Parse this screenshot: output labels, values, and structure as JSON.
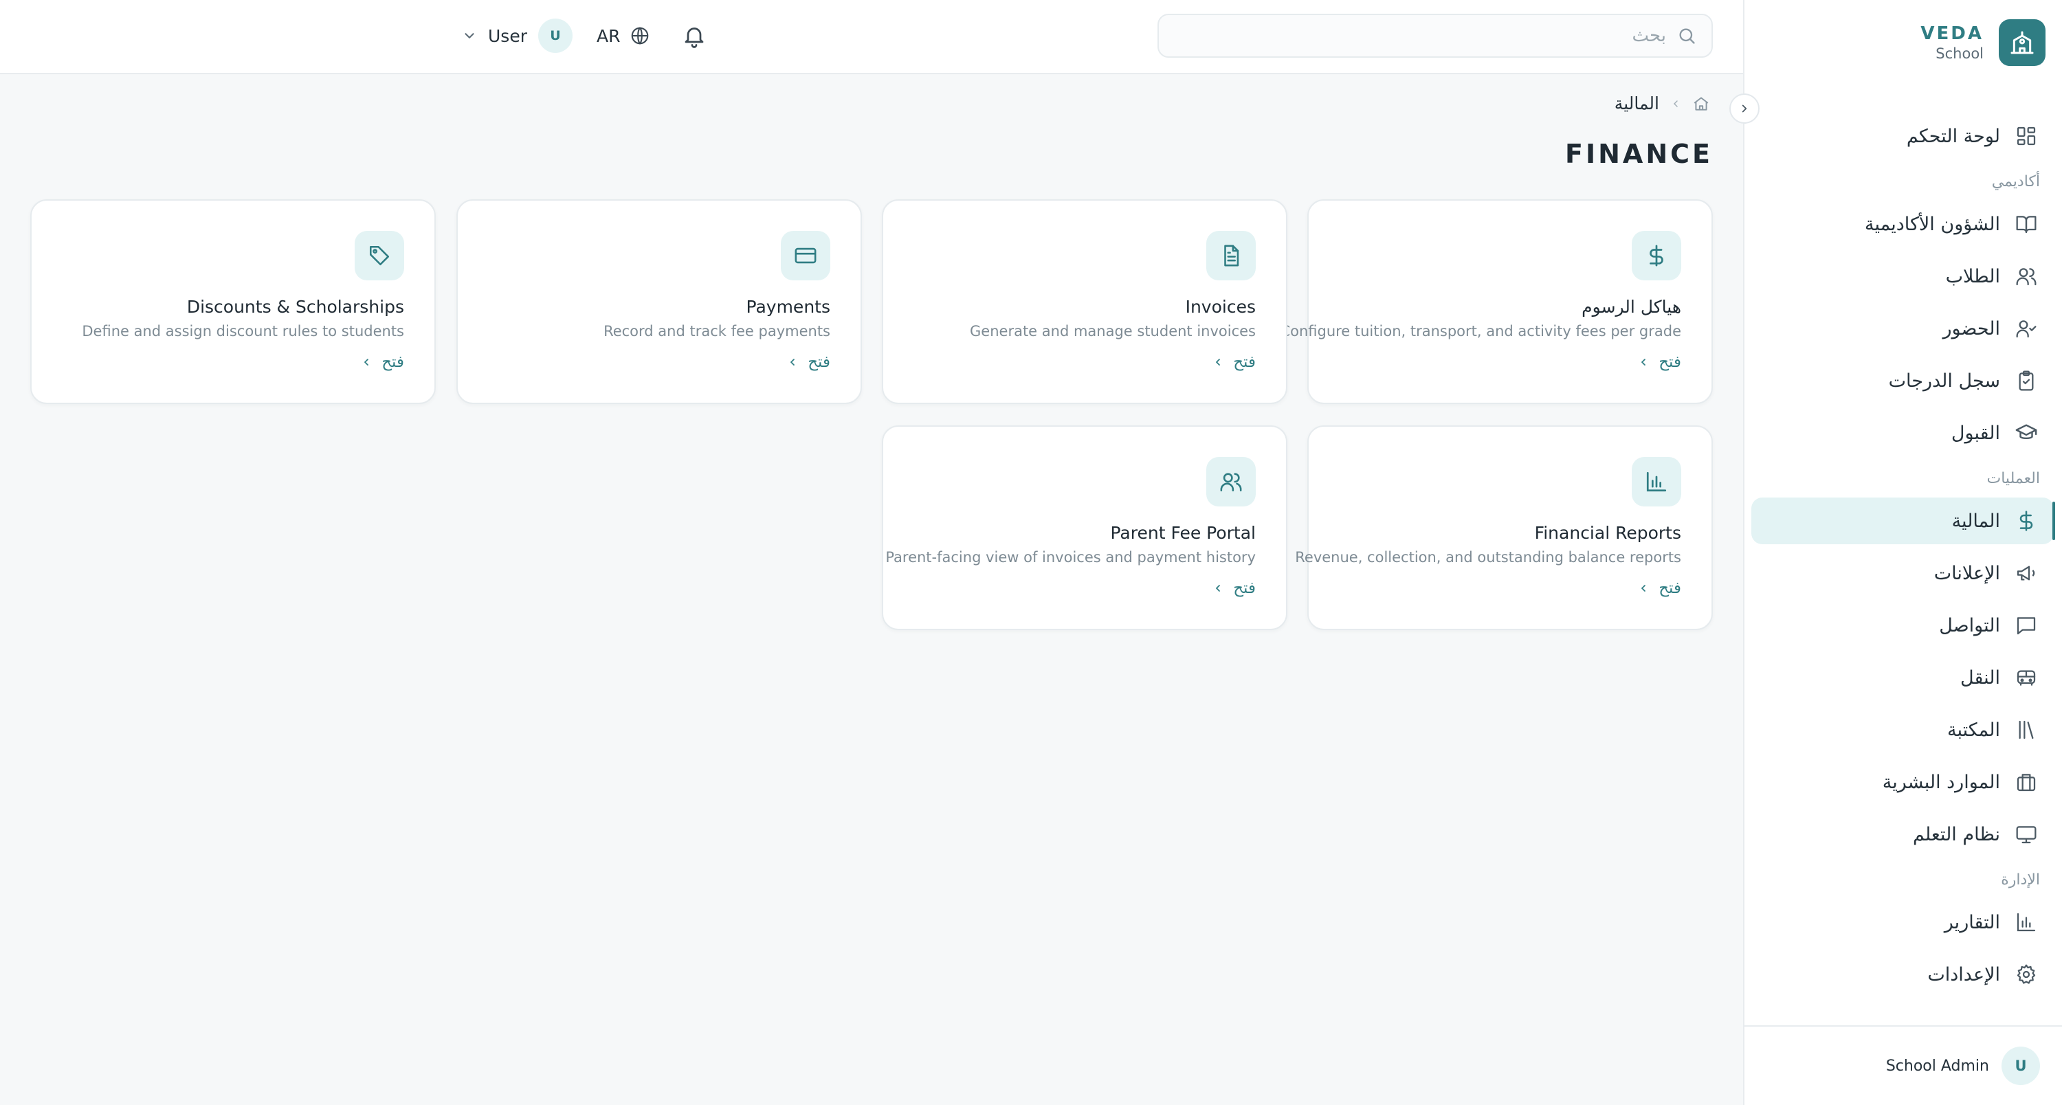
{
  "brand": {
    "name": "VEDA",
    "subtitle": "School"
  },
  "topbar": {
    "search_placeholder": "بحث",
    "language": "AR",
    "user_name": "User",
    "user_initial": "U"
  },
  "sidebar": {
    "dashboard": "لوحة التحكم",
    "section_academic": "أكاديمي",
    "academic_affairs": "الشؤون الأكاديمية",
    "students": "الطلاب",
    "attendance": "الحضور",
    "gradebook": "سجل الدرجات",
    "admissions": "القبول",
    "section_operations": "العمليات",
    "finance": "المالية",
    "announcements": "الإعلانات",
    "communication": "التواصل",
    "transport": "النقل",
    "library": "المكتبة",
    "hr": "الموارد البشرية",
    "lms": "نظام التعلم",
    "section_admin": "الإدارة",
    "reports": "التقارير",
    "settings": "الإعدادات",
    "footer_name": "School Admin",
    "footer_initial": "U"
  },
  "breadcrumb": {
    "current": "المالية"
  },
  "page_title": "FINANCE",
  "cards": [
    {
      "title": "هياكل الرسوم",
      "desc": "Configure tuition, transport, and activity fees per grade",
      "open": "فتح",
      "icon": "dollar-icon"
    },
    {
      "title": "Invoices",
      "desc": "Generate and manage student invoices",
      "open": "فتح",
      "icon": "document-icon"
    },
    {
      "title": "Payments",
      "desc": "Record and track fee payments",
      "open": "فتح",
      "icon": "credit-card-icon"
    },
    {
      "title": "Discounts & Scholarships",
      "desc": "Define and assign discount rules to students",
      "open": "فتح",
      "icon": "tag-icon"
    },
    {
      "title": "Financial Reports",
      "desc": "Revenue, collection, and outstanding balance reports",
      "open": "فتح",
      "icon": "bar-chart-icon"
    },
    {
      "title": "Parent Fee Portal",
      "desc": "Parent-facing view of invoices and payment history",
      "open": "فتح",
      "icon": "users-icon"
    }
  ],
  "colors": {
    "accent": "#2f7d83",
    "accent_light": "#e3f3f4",
    "background": "#f6f8f9"
  }
}
